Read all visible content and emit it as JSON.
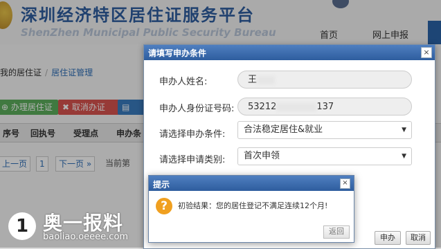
{
  "header": {
    "site_title": "深圳经济特区居住证服务平台",
    "site_subtitle": "ShenZhen Municipal Public Security Bureau",
    "nav": [
      "首页",
      "网上申报"
    ]
  },
  "breadcrumb": {
    "prefix": "我的居住证",
    "current": "居住证管理"
  },
  "toolbar": {
    "apply": "办理居住证",
    "cancel": "取消办证"
  },
  "table": {
    "headers": [
      "序号",
      "回执号",
      "受理点",
      "申办条"
    ]
  },
  "pager": {
    "prev": "上一页",
    "page": "1",
    "next": "下一页 »",
    "current_label": "当前第"
  },
  "dialog": {
    "title": "请填写申办条件",
    "close_glyph": "×",
    "fields": {
      "name": {
        "label": "申办人姓名:",
        "value": "王"
      },
      "id": {
        "label": "申办人身份证号码:",
        "prefix": "53212",
        "suffix": "137"
      },
      "condition": {
        "label": "请选择申办条件:",
        "value": "合法稳定居住&就业"
      },
      "type": {
        "label": "请选择申请类别:",
        "value": "首次申领"
      }
    },
    "buttons": {
      "apply": "申办",
      "cancel": "取消"
    }
  },
  "alert": {
    "title": "提示",
    "close_glyph": "×",
    "icon_glyph": "?",
    "message": "初验结果：您的居住登记不满足连续12个月!",
    "button": "返回"
  },
  "watermark": {
    "logo_glyph": "1",
    "brand": "奥一报料",
    "url": "baoliao.oeeee.com"
  },
  "colors": {
    "titlebar": "#2e5d9e",
    "accent_blue": "#2f5da0",
    "warn": "#f0a020"
  }
}
